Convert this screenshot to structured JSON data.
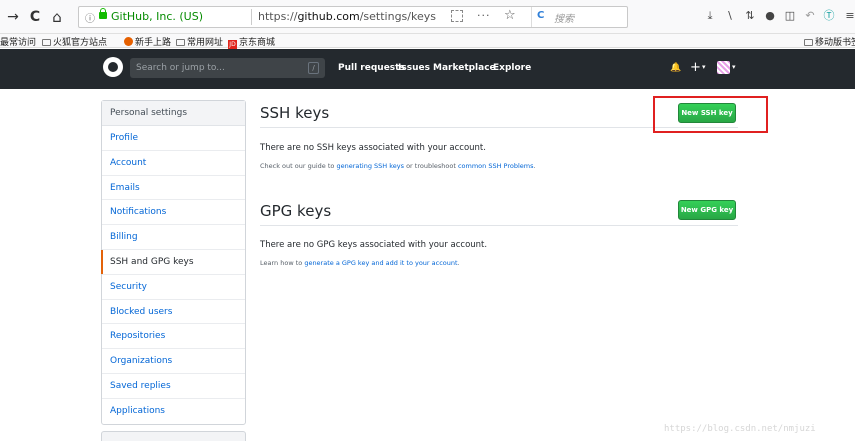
{
  "browser": {
    "back_icon": "arrow-back-icon",
    "back_glyph": "→",
    "reload_glyph": "C",
    "home_glyph": "⌂",
    "info_glyph": "ⓘ",
    "identity": "GitHub, Inc. (US)",
    "url_prefix": "https://",
    "url_host": "github.com",
    "url_path": "/settings/keys",
    "more_glyph": "···",
    "star_glyph": "☆",
    "search_engine_glyph": "C",
    "search_placeholder": "搜索",
    "toolbar_glyphs": [
      "⤓",
      "\\",
      "⇅",
      "●",
      "◫",
      "↶",
      "Ⓣ",
      "≡"
    ]
  },
  "bookmarks": {
    "items": [
      {
        "label": "最常访问",
        "icon": "none"
      },
      {
        "label": "火狐官方站点",
        "icon": "folder-icon"
      },
      {
        "label": "新手上路",
        "icon": "firefox-icon"
      },
      {
        "label": "常用网址",
        "icon": "folder-icon"
      },
      {
        "label": "京东商城",
        "icon": "jd-icon",
        "icon_text": "JD"
      }
    ],
    "mobile": "移动版书签"
  },
  "github_header": {
    "search_placeholder": "Search or jump to...",
    "slash_key": "/",
    "nav": [
      "Pull requests",
      "Issues",
      "Marketplace",
      "Explore"
    ],
    "bell_glyph": "🔔",
    "plus_glyph": "+",
    "caret_glyph": "▾"
  },
  "sidebar": {
    "header": "Personal settings",
    "items": [
      {
        "label": "Profile",
        "selected": false
      },
      {
        "label": "Account",
        "selected": false
      },
      {
        "label": "Emails",
        "selected": false
      },
      {
        "label": "Notifications",
        "selected": false
      },
      {
        "label": "Billing",
        "selected": false
      },
      {
        "label": "SSH and GPG keys",
        "selected": true
      },
      {
        "label": "Security",
        "selected": false
      },
      {
        "label": "Blocked users",
        "selected": false
      },
      {
        "label": "Repositories",
        "selected": false
      },
      {
        "label": "Organizations",
        "selected": false
      },
      {
        "label": "Saved replies",
        "selected": false
      },
      {
        "label": "Applications",
        "selected": false
      }
    ]
  },
  "ssh": {
    "title": "SSH keys",
    "button": "New SSH key",
    "empty": "There are no SSH keys associated with your account.",
    "note_prefix": "Check out our guide to ",
    "note_link1": "generating SSH keys",
    "note_middle": " or troubleshoot ",
    "note_link2": "common SSH Problems",
    "note_suffix": "."
  },
  "gpg": {
    "title": "GPG keys",
    "button": "New GPG key",
    "empty": "There are no GPG keys associated with your account.",
    "note_prefix": "Learn how to ",
    "note_link": "generate a GPG key and add it to your account",
    "note_suffix": "."
  },
  "watermark": "https://blog.csdn.net/nmjuzi",
  "colors": {
    "header_bg": "#24292e",
    "link": "#0366d6",
    "button_green": "#28a745",
    "highlight_red": "#e02020",
    "selected_accent": "#e36209"
  }
}
